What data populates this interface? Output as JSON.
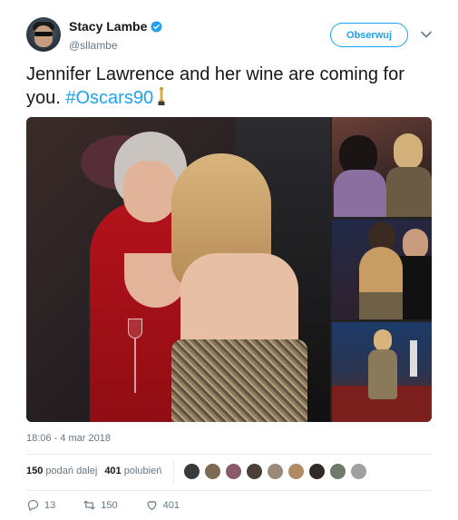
{
  "author": {
    "display_name": "Stacy Lambe",
    "handle": "@sllambe",
    "verified": true
  },
  "follow_button": {
    "label": "Obserwuj"
  },
  "tweet": {
    "text": "Jennifer Lawrence and her wine are coming for you. ",
    "hashtag": "#Oscars90",
    "emoji": "oscar-trophy-icon",
    "media_count": 4
  },
  "timestamp": "18:06 - 4 mar 2018",
  "stats": {
    "retweets_count": "150",
    "retweets_label": "podań dalej",
    "likes_count": "401",
    "likes_label": "polubień",
    "liker_avatar_count": 9
  },
  "actions": {
    "replies": "13",
    "retweets": "150",
    "likes": "401"
  },
  "colors": {
    "accent": "#1da1f2",
    "text": "#14171a",
    "muted": "#657786",
    "divider": "#e6ecf0"
  }
}
